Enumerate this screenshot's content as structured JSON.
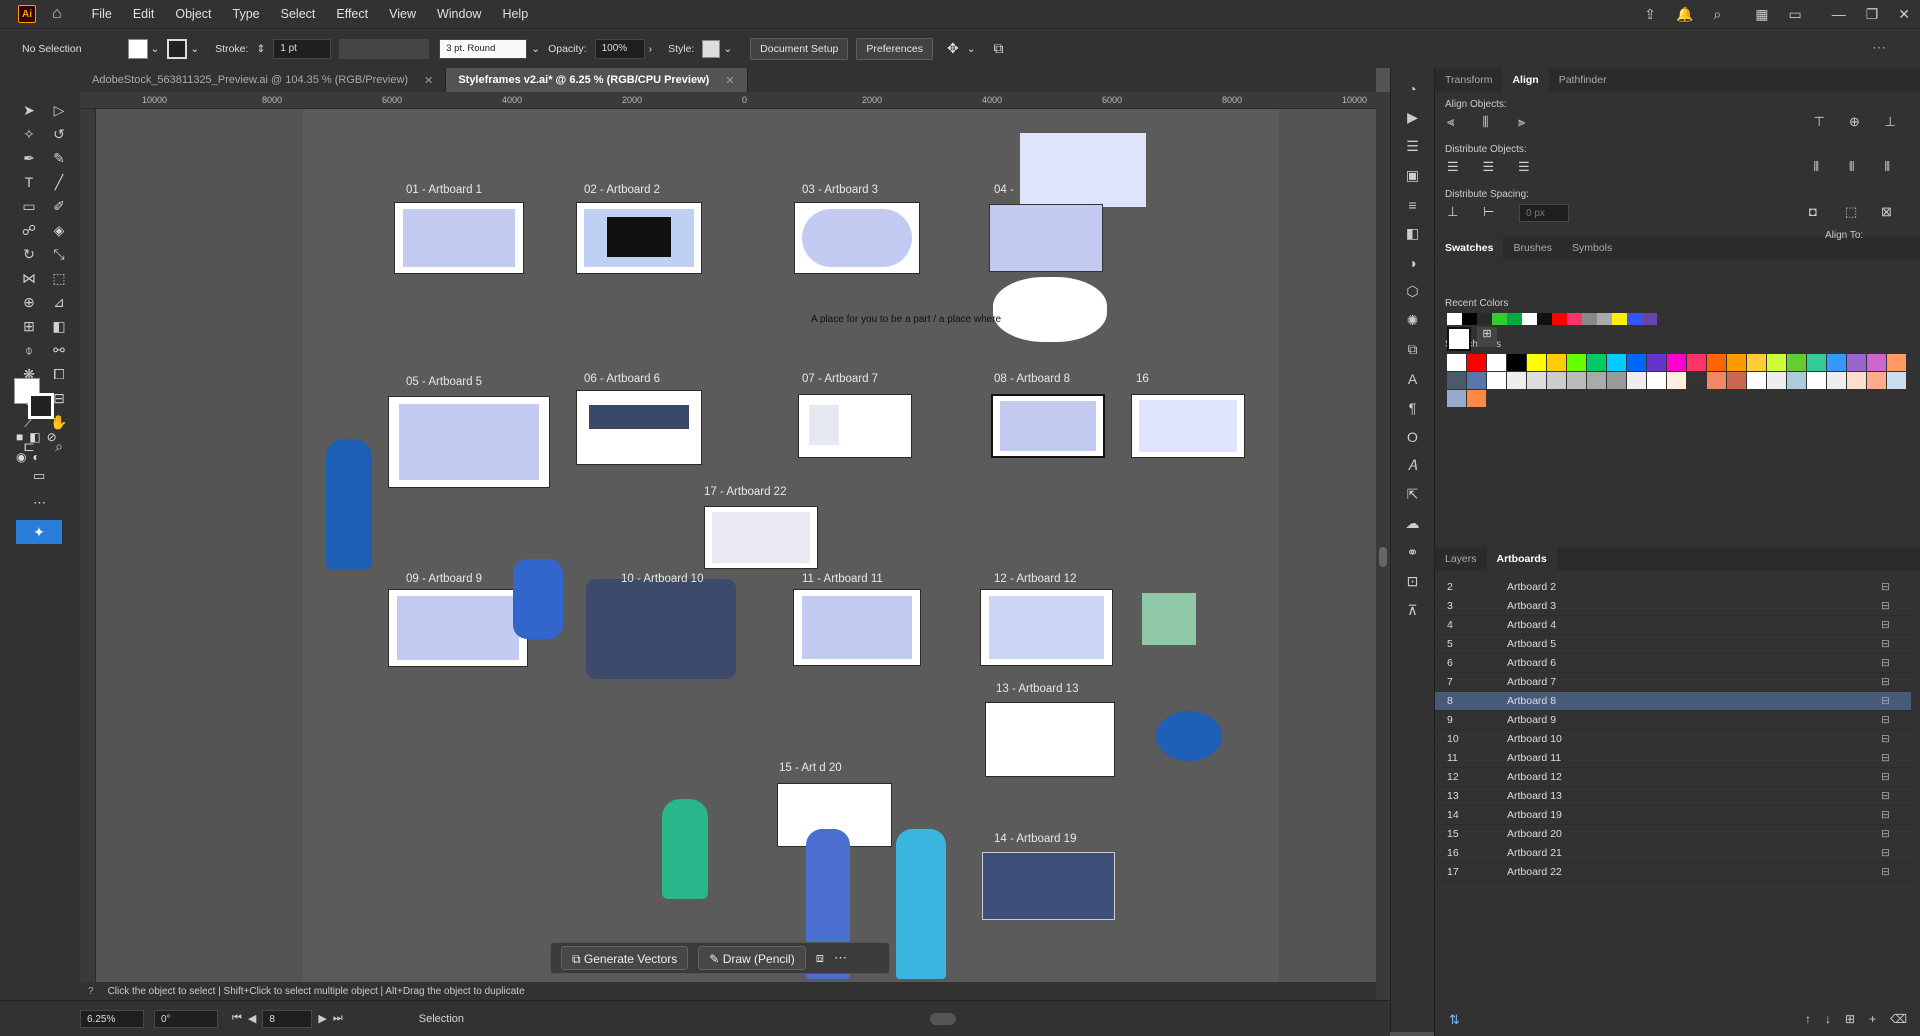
{
  "app": {
    "logo": "Ai"
  },
  "menu": [
    "File",
    "Edit",
    "Object",
    "Type",
    "Select",
    "Effect",
    "View",
    "Window",
    "Help"
  ],
  "control": {
    "selection": "No Selection",
    "stroke_label": "Stroke:",
    "stroke_value": "1 pt",
    "brush": "3 pt. Round",
    "opacity_label": "Opacity:",
    "opacity_value": "100%",
    "style_label": "Style:",
    "doc_setup": "Document Setup",
    "preferences": "Preferences"
  },
  "tabs": [
    {
      "label": "AdobeStock_563811325_Preview.ai @ 104.35 % (RGB/Preview)"
    },
    {
      "label": "Styleframes v2.ai* @ 6.25 % (RGB/CPU Preview)"
    }
  ],
  "ruler": {
    "ticks": [
      "10000",
      "8000",
      "6000",
      "4000",
      "2000",
      "0",
      "2000",
      "4000",
      "6000",
      "8000",
      "10000"
    ]
  },
  "artboards": [
    {
      "label": "01 - Artboard 1"
    },
    {
      "label": "02 - Artboard 2"
    },
    {
      "label": "03 - Artboard 3"
    },
    {
      "label": "04 -"
    },
    {
      "label": "05 - Artboard 5"
    },
    {
      "label": "06 - Artboard 6"
    },
    {
      "label": "07 - Artboard 7"
    },
    {
      "label": "08 - Artboard 8"
    },
    {
      "label": "16"
    },
    {
      "label": "17 - Artboard 22"
    },
    {
      "label": "09 - Artboard 9"
    },
    {
      "label": "10 - Artboard 10"
    },
    {
      "label": "11 - Artboard 11"
    },
    {
      "label": "12 - Artboard 12"
    },
    {
      "label": "13 - Artboard 13"
    },
    {
      "label": "15 - Art     d 20"
    },
    {
      "label": "14 - Artboard 19"
    }
  ],
  "canvas_text": "A place for you to be a part / a place where",
  "right_panel": {
    "tabs": [
      "Transform",
      "Align",
      "Pathfinder"
    ],
    "align_objects": "Align Objects:",
    "distribute_objects": "Distribute Objects:",
    "distribute_spacing": "Distribute Spacing:",
    "align_to": "Align To:",
    "spacing_value": "0 px",
    "swatch_tabs": [
      "Swatches",
      "Brushes",
      "Symbols"
    ],
    "recent_colors": "Recent Colors",
    "swatch_tiles": "Swatch Tiles",
    "layers_tabs": [
      "Layers",
      "Artboards"
    ],
    "artboard_rows": [
      {
        "n": "2",
        "name": "Artboard 2"
      },
      {
        "n": "3",
        "name": "Artboard 3"
      },
      {
        "n": "4",
        "name": "Artboard 4"
      },
      {
        "n": "5",
        "name": "Artboard 5"
      },
      {
        "n": "6",
        "name": "Artboard 6"
      },
      {
        "n": "7",
        "name": "Artboard 7"
      },
      {
        "n": "8",
        "name": "Artboard 8"
      },
      {
        "n": "9",
        "name": "Artboard 9"
      },
      {
        "n": "10",
        "name": "Artboard 10"
      },
      {
        "n": "11",
        "name": "Artboard 11"
      },
      {
        "n": "12",
        "name": "Artboard 12"
      },
      {
        "n": "13",
        "name": "Artboard 13"
      },
      {
        "n": "14",
        "name": "Artboard 19"
      },
      {
        "n": "15",
        "name": "Artboard 20"
      },
      {
        "n": "16",
        "name": "Artboard 21"
      },
      {
        "n": "17",
        "name": "Artboard 22"
      }
    ]
  },
  "recent_colors": [
    "#ffffff",
    "#000000",
    "#2a2a2a",
    "#33cc33",
    "#00aa44",
    "#ffffff",
    "#111111",
    "#ff0000",
    "#ff3366",
    "#888888",
    "#aaaaaa",
    "#ffee00",
    "#3355ff",
    "#6644aa"
  ],
  "swatch_colors": [
    "#ffffff",
    "#ff0000",
    "#ffffff",
    "#000000",
    "#ffff00",
    "#ffcc00",
    "#66ff00",
    "#00cc66",
    "#00ccff",
    "#0066ff",
    "#6633cc",
    "#ff00cc",
    "#ff3366",
    "#ff6600",
    "#ff9900",
    "#ffcc33",
    "#ccff33",
    "#66cc33",
    "#33cc99",
    "#3399ff",
    "#9966cc",
    "#cc66cc",
    "#ff9966",
    "#4a5a6a",
    "#5577aa",
    "#ffffff",
    "#eeeeee",
    "#dddddd",
    "#cccccc",
    "#bbbbbb",
    "#aaaaaa",
    "#999999",
    "#eeeeee",
    "#ffffff",
    "#ffeedd",
    "#333333",
    "#ee8866",
    "#cc6655",
    "#ffffff",
    "#eeeeee",
    "#aaccdd",
    "#ffffff",
    "#eeeeee",
    "#ffddcc",
    "#ffaa88",
    "#ccddee",
    "#99aacc",
    "#ff8844"
  ],
  "statusbar": {
    "hint": "Click the object to select  |  Shift+Click to select multiple object  |  Alt+Drag the object to duplicate"
  },
  "bottombar": {
    "zoom": "6.25%",
    "rotate": "0°",
    "artboard": "8",
    "mode": "Selection"
  },
  "ctxbar": {
    "generate": "Generate Vectors",
    "draw": "Draw (Pencil)"
  }
}
